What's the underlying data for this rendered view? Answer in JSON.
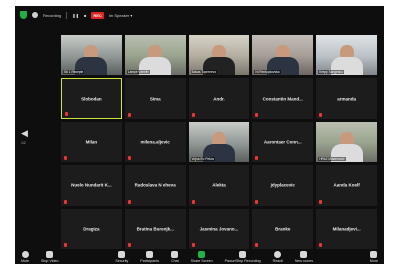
{
  "topbar": {
    "recording_text": "Recording",
    "rec_badge": "REC",
    "view_label": "Im Speaker ▾"
  },
  "participants": [
    {
      "name": "",
      "video": true,
      "label": "Sb 1 Recepte"
    },
    {
      "name": "",
      "video": true,
      "label": "Lampe Vatrelle"
    },
    {
      "name": "",
      "video": true,
      "label": "Bokas Toprenevo"
    },
    {
      "name": "",
      "video": true,
      "label": "Ni Rentupkovska"
    },
    {
      "name": "",
      "video": true,
      "label": "Krepp Sangesko"
    },
    {
      "name": "Slobodan",
      "video": false,
      "active": true
    },
    {
      "name": "Sima",
      "video": false
    },
    {
      "name": "Andr.",
      "video": false
    },
    {
      "name": "Constantin Mand...",
      "video": false
    },
    {
      "name": "armanda",
      "video": false
    },
    {
      "name": "Milan",
      "video": false
    },
    {
      "name": "milena.aljevic",
      "video": false
    },
    {
      "name": "",
      "video": true,
      "label": "Vojna Eo Pekov"
    },
    {
      "name": "Aarontaer Conn...",
      "video": false
    },
    {
      "name": "",
      "video": true,
      "label": "HRbZ Mladenović"
    },
    {
      "name": "Nuelo Nundarit K...",
      "video": false
    },
    {
      "name": "Radoslava N eheva",
      "video": false
    },
    {
      "name": "Alekta",
      "video": false
    },
    {
      "name": "jdyplacevic",
      "video": false
    },
    {
      "name": "Aanda Koelf",
      "video": false
    },
    {
      "name": "Dragiza",
      "video": false
    },
    {
      "name": "Bratina Burenjk...",
      "video": false
    },
    {
      "name": "Jasmina Jovano...",
      "video": false
    },
    {
      "name": "Branke",
      "video": false
    },
    {
      "name": "Milanadjevi...",
      "video": false
    }
  ],
  "sidebar": {
    "prev_arrow": "◀",
    "page": "1/2"
  },
  "toolbar": {
    "left": [
      {
        "label": "Mute",
        "icon": "microphone-icon"
      },
      {
        "label": "Stop Video",
        "icon": "video-camera-icon"
      }
    ],
    "center": [
      {
        "label": "Security",
        "icon": "shield-icon"
      },
      {
        "label": "Participants",
        "icon": "participants-icon"
      },
      {
        "label": "Chat",
        "icon": "chat-icon"
      },
      {
        "label": "Share Screen",
        "icon": "share-screen-icon"
      },
      {
        "label": "Pause/Stop Recording",
        "icon": "recording-icon"
      },
      {
        "label": "Reacti",
        "icon": "reactions-icon"
      },
      {
        "label": "New rooms",
        "icon": "breakout-rooms-icon"
      }
    ],
    "right": [
      {
        "label": "More",
        "icon": "more-icon"
      }
    ]
  }
}
